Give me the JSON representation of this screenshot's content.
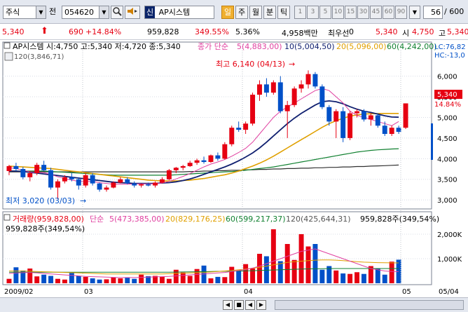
{
  "toolbar": {
    "market_type": "주식",
    "prefix_label": "전",
    "stock_code": "054620",
    "stock_badge": "신",
    "stock_name": "AP시스템",
    "period_daily": "일",
    "period_weekly": "주",
    "period_monthly": "월",
    "period_minute": "분",
    "period_tick": "틱",
    "intervals": [
      "1",
      "3",
      "5",
      "10",
      "15",
      "30",
      "45",
      "60",
      "90"
    ],
    "count": "56",
    "count_total": "/ 600"
  },
  "quote": {
    "price": "5,340",
    "change": "690",
    "change_pct": "+14.84%",
    "volume": "959,828",
    "volume_ratio": "349.55%",
    "turnover": "5.36%",
    "amount": "4,958백만",
    "investor_label": "최우선",
    "investor_value": "0",
    "last_price": "5,340",
    "open_label": "시",
    "open_value": "4,750",
    "high_label": "고",
    "high_value": "5,340"
  },
  "price_panel": {
    "ohlc_label": "AP시스템 시:4,750 고:5,340 저:4,720 종:5,340",
    "ma_title": "종가 단순",
    "ma5": "5(4,883,00)",
    "ma10": "10(5,004,50)",
    "ma20": "20(5,096,00)",
    "ma60": "60(4,242,00)",
    "ma120": "120(3,846,71)",
    "lc_label": "LC:76,82",
    "hc_label": "HC:-13,0",
    "max_label": "최고 6,140 (04/13)",
    "min_label": "최저 3,020 (03/03)",
    "last_price_tag": "5,340",
    "last_pct_tag": "14.84%",
    "y_ticks": [
      "6,000",
      "5,500",
      "5,000",
      "4,500",
      "4,000",
      "3,500",
      "3,000"
    ]
  },
  "volume_panel": {
    "title": "거래량(959,828,00)",
    "ma_title": "단순",
    "ma5": "5(473,385,00)",
    "ma20": "20(829,176,25)",
    "ma60": "60(599,217,37)",
    "ma120": "120(425,644,31)",
    "current_right": "959,828주(349,54%)",
    "current_left": "959,828주(349,54%)",
    "y_ticks": [
      "2,000K",
      "1,000K"
    ]
  },
  "x_axis": {
    "labels": [
      "2009/02",
      "03",
      "04",
      "05",
      "05/04"
    ]
  },
  "colors": {
    "up": "#e60012",
    "down": "#0050c8",
    "ma5": "#e040a0",
    "ma10": "#102070",
    "ma20": "#e0a000",
    "ma60": "#108030",
    "ma120": "#303030"
  },
  "chart_data": {
    "type": "candlestick",
    "candles": [
      {
        "o": 3700,
        "h": 3850,
        "l": 3600,
        "c": 3820
      },
      {
        "o": 3820,
        "h": 3900,
        "l": 3700,
        "c": 3750
      },
      {
        "o": 3750,
        "h": 3800,
        "l": 3500,
        "c": 3550
      },
      {
        "o": 3550,
        "h": 3700,
        "l": 3450,
        "c": 3650
      },
      {
        "o": 3650,
        "h": 3900,
        "l": 3600,
        "c": 3850
      },
      {
        "o": 3850,
        "h": 3950,
        "l": 3700,
        "c": 3720
      },
      {
        "o": 3720,
        "h": 3780,
        "l": 3250,
        "c": 3300
      },
      {
        "o": 3300,
        "h": 3500,
        "l": 3020,
        "c": 3450
      },
      {
        "o": 3450,
        "h": 3600,
        "l": 3400,
        "c": 3550
      },
      {
        "o": 3550,
        "h": 3650,
        "l": 3450,
        "c": 3500
      },
      {
        "o": 3500,
        "h": 3550,
        "l": 3250,
        "c": 3350
      },
      {
        "o": 3350,
        "h": 3650,
        "l": 3300,
        "c": 3600
      },
      {
        "o": 3600,
        "h": 3650,
        "l": 3350,
        "c": 3400
      },
      {
        "o": 3400,
        "h": 3420,
        "l": 3200,
        "c": 3250
      },
      {
        "o": 3250,
        "h": 3350,
        "l": 3200,
        "c": 3300
      },
      {
        "o": 3300,
        "h": 3450,
        "l": 3280,
        "c": 3420
      },
      {
        "o": 3420,
        "h": 3550,
        "l": 3400,
        "c": 3500
      },
      {
        "o": 3500,
        "h": 3550,
        "l": 3380,
        "c": 3400
      },
      {
        "o": 3400,
        "h": 3450,
        "l": 3300,
        "c": 3350
      },
      {
        "o": 3350,
        "h": 3400,
        "l": 3300,
        "c": 3380
      },
      {
        "o": 3380,
        "h": 3420,
        "l": 3330,
        "c": 3350
      },
      {
        "o": 3350,
        "h": 3450,
        "l": 3300,
        "c": 3420
      },
      {
        "o": 3420,
        "h": 3550,
        "l": 3400,
        "c": 3500
      },
      {
        "o": 3500,
        "h": 3750,
        "l": 3480,
        "c": 3720
      },
      {
        "o": 3720,
        "h": 3800,
        "l": 3650,
        "c": 3780
      },
      {
        "o": 3780,
        "h": 3850,
        "l": 3720,
        "c": 3820
      },
      {
        "o": 3820,
        "h": 3950,
        "l": 3800,
        "c": 3900
      },
      {
        "o": 3900,
        "h": 4000,
        "l": 3850,
        "c": 3960
      },
      {
        "o": 3960,
        "h": 4050,
        "l": 3880,
        "c": 3920
      },
      {
        "o": 3920,
        "h": 4100,
        "l": 3900,
        "c": 4080
      },
      {
        "o": 4080,
        "h": 4150,
        "l": 3950,
        "c": 4000
      },
      {
        "o": 4000,
        "h": 4400,
        "l": 3980,
        "c": 4350
      },
      {
        "o": 4350,
        "h": 4800,
        "l": 4300,
        "c": 4750
      },
      {
        "o": 4750,
        "h": 4900,
        "l": 4650,
        "c": 4700
      },
      {
        "o": 4700,
        "h": 4900,
        "l": 4600,
        "c": 4850
      },
      {
        "o": 4850,
        "h": 5600,
        "l": 4800,
        "c": 5550
      },
      {
        "o": 5550,
        "h": 5900,
        "l": 5400,
        "c": 5800
      },
      {
        "o": 5800,
        "h": 5950,
        "l": 5500,
        "c": 5600
      },
      {
        "o": 5600,
        "h": 5900,
        "l": 5550,
        "c": 5850
      },
      {
        "o": 5850,
        "h": 6000,
        "l": 5100,
        "c": 5150
      },
      {
        "o": 5150,
        "h": 5400,
        "l": 4500,
        "c": 5300
      },
      {
        "o": 5300,
        "h": 5750,
        "l": 5250,
        "c": 5700
      },
      {
        "o": 5700,
        "h": 5900,
        "l": 5600,
        "c": 5800
      },
      {
        "o": 5800,
        "h": 6140,
        "l": 5700,
        "c": 6050
      },
      {
        "o": 6050,
        "h": 6100,
        "l": 5700,
        "c": 5750
      },
      {
        "o": 5750,
        "h": 5800,
        "l": 5200,
        "c": 5250
      },
      {
        "o": 5250,
        "h": 5300,
        "l": 4800,
        "c": 4900
      },
      {
        "o": 4900,
        "h": 5200,
        "l": 4500,
        "c": 5150
      },
      {
        "o": 5150,
        "h": 5250,
        "l": 4400,
        "c": 4500
      },
      {
        "o": 4500,
        "h": 5150,
        "l": 4450,
        "c": 5100
      },
      {
        "o": 5100,
        "h": 5200,
        "l": 5000,
        "c": 5150
      },
      {
        "o": 5150,
        "h": 5200,
        "l": 4900,
        "c": 4950
      },
      {
        "o": 4950,
        "h": 5100,
        "l": 4800,
        "c": 5050
      },
      {
        "o": 5050,
        "h": 5100,
        "l": 4750,
        "c": 4800
      },
      {
        "o": 4800,
        "h": 4900,
        "l": 4550,
        "c": 4600
      },
      {
        "o": 4600,
        "h": 4800,
        "l": 4550,
        "c": 4750
      },
      {
        "o": 4750,
        "h": 4800,
        "l": 4600,
        "c": 4650
      },
      {
        "o": 4750,
        "h": 5340,
        "l": 4720,
        "c": 5340
      }
    ],
    "volume_k": [
      180,
      650,
      520,
      600,
      280,
      350,
      300,
      180,
      150,
      420,
      300,
      260,
      200,
      150,
      160,
      240,
      200,
      230,
      180,
      350,
      290,
      300,
      260,
      180,
      550,
      440,
      300,
      580,
      720,
      200,
      260,
      250,
      670,
      500,
      780,
      600,
      1200,
      1100,
      2200,
      900,
      1600,
      950,
      2000,
      1500,
      1600,
      550,
      700,
      520,
      400,
      380,
      450,
      380,
      700,
      600,
      350,
      880,
      960
    ],
    "ma5": [
      3780,
      3760,
      3720,
      3680,
      3660,
      3660,
      3620,
      3560,
      3520,
      3480,
      3450,
      3450,
      3450,
      3420,
      3400,
      3380,
      3380,
      3380,
      3390,
      3390,
      3390,
      3390,
      3410,
      3450,
      3510,
      3570,
      3640,
      3720,
      3800,
      3870,
      3920,
      3980,
      4060,
      4150,
      4250,
      4400,
      4600,
      4800,
      5000,
      5150,
      5250,
      5350,
      5450,
      5550,
      5650,
      5700,
      5650,
      5500,
      5350,
      5150,
      5050,
      5000,
      4950,
      4900,
      4850,
      4800,
      4900
    ],
    "ma10": [
      3700,
      3700,
      3690,
      3670,
      3650,
      3630,
      3610,
      3590,
      3570,
      3550,
      3530,
      3510,
      3490,
      3470,
      3450,
      3430,
      3420,
      3410,
      3400,
      3400,
      3400,
      3400,
      3410,
      3420,
      3440,
      3470,
      3510,
      3560,
      3620,
      3680,
      3740,
      3800,
      3870,
      3950,
      4040,
      4140,
      4260,
      4400,
      4550,
      4700,
      4850,
      4980,
      5100,
      5200,
      5300,
      5380,
      5400,
      5380,
      5330,
      5260,
      5200,
      5150,
      5120,
      5080,
      5040,
      5010,
      5004
    ],
    "ma20": [
      3820,
      3810,
      3800,
      3790,
      3780,
      3770,
      3760,
      3740,
      3720,
      3700,
      3680,
      3660,
      3640,
      3620,
      3600,
      3580,
      3560,
      3540,
      3520,
      3500,
      3480,
      3470,
      3460,
      3460,
      3460,
      3470,
      3480,
      3500,
      3520,
      3550,
      3580,
      3610,
      3650,
      3700,
      3760,
      3820,
      3890,
      3970,
      4060,
      4160,
      4260,
      4360,
      4460,
      4560,
      4660,
      4760,
      4850,
      4920,
      4980,
      5030,
      5060,
      5080,
      5090,
      5095,
      5096,
      5096,
      5096
    ],
    "ma60": [
      3700,
      3700,
      3700,
      3700,
      3700,
      3700,
      3690,
      3680,
      3670,
      3660,
      3650,
      3640,
      3630,
      3620,
      3610,
      3600,
      3600,
      3600,
      3600,
      3600,
      3600,
      3600,
      3600,
      3600,
      3610,
      3620,
      3630,
      3640,
      3650,
      3660,
      3670,
      3680,
      3690,
      3700,
      3720,
      3740,
      3760,
      3780,
      3800,
      3830,
      3860,
      3890,
      3920,
      3950,
      3980,
      4010,
      4040,
      4070,
      4100,
      4130,
      4160,
      4180,
      4200,
      4215,
      4225,
      4235,
      4242
    ],
    "ma120": [
      3680,
      3680,
      3680,
      3680,
      3680,
      3680,
      3680,
      3680,
      3680,
      3680,
      3680,
      3680,
      3680,
      3680,
      3680,
      3680,
      3680,
      3680,
      3680,
      3680,
      3680,
      3680,
      3680,
      3680,
      3680,
      3680,
      3690,
      3690,
      3700,
      3700,
      3710,
      3710,
      3720,
      3720,
      3730,
      3730,
      3740,
      3740,
      3750,
      3750,
      3760,
      3760,
      3770,
      3770,
      3780,
      3780,
      3790,
      3790,
      3800,
      3800,
      3810,
      3810,
      3820,
      3825,
      3830,
      3838,
      3846
    ],
    "vol_ma5": [
      400,
      420,
      430,
      440,
      420,
      400,
      380,
      360,
      340,
      320,
      300,
      280,
      270,
      260,
      250,
      240,
      230,
      230,
      230,
      240,
      250,
      260,
      270,
      280,
      300,
      320,
      340,
      360,
      380,
      400,
      420,
      440,
      480,
      520,
      560,
      620,
      700,
      800,
      900,
      1000,
      1100,
      1200,
      1300,
      1350,
      1400,
      1300,
      1200,
      1100,
      1000,
      900,
      800,
      700,
      600,
      550,
      500,
      480,
      473
    ],
    "vol_ma20": [
      500,
      500,
      500,
      490,
      480,
      470,
      460,
      450,
      440,
      430,
      420,
      410,
      400,
      390,
      380,
      380,
      380,
      380,
      380,
      380,
      380,
      380,
      380,
      390,
      400,
      410,
      420,
      430,
      440,
      460,
      480,
      500,
      520,
      550,
      580,
      610,
      650,
      700,
      750,
      800,
      850,
      880,
      900,
      920,
      940,
      950,
      950,
      940,
      920,
      900,
      880,
      860,
      850,
      840,
      835,
      830,
      829
    ],
    "vol_ma60": [
      450,
      450,
      450,
      450,
      450,
      450,
      450,
      450,
      450,
      450,
      450,
      450,
      450,
      450,
      450,
      450,
      450,
      450,
      450,
      450,
      450,
      450,
      450,
      450,
      455,
      460,
      465,
      470,
      475,
      480,
      485,
      490,
      495,
      500,
      505,
      510,
      520,
      530,
      540,
      550,
      560,
      570,
      580,
      585,
      590,
      595,
      598,
      600,
      600,
      600,
      600,
      600,
      600,
      600,
      599,
      599,
      599
    ],
    "price_range": [
      2850,
      6350
    ],
    "volume_range_k": [
      0,
      2400
    ]
  }
}
